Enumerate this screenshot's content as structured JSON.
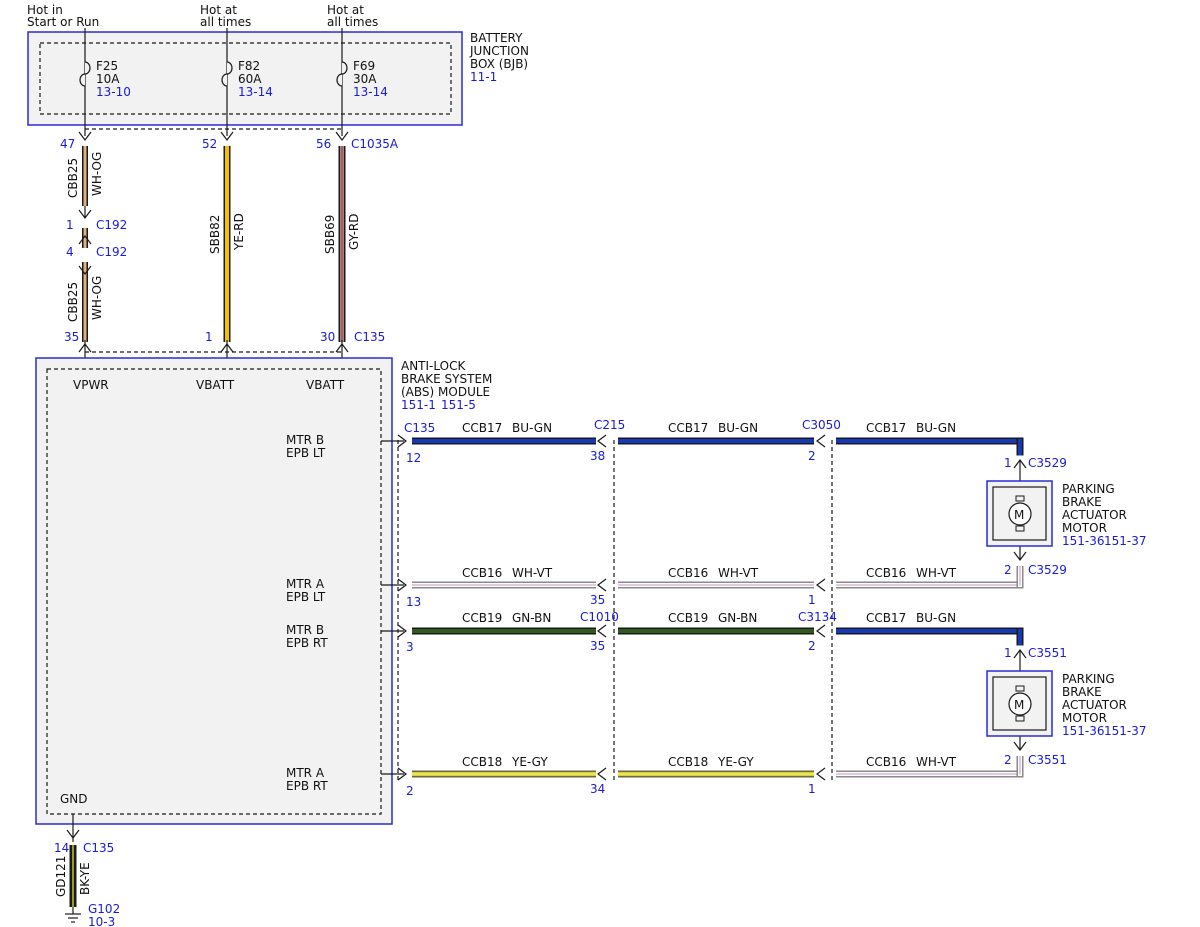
{
  "colors": {
    "label": "#111111",
    "ref": "#1a1adb",
    "box_border": "#2b2bd9",
    "box_fill": "#f2f2f2",
    "BU-GN": "#1538b8",
    "WH-VT": "#cfa4cf",
    "GN-BN": "#2f5a1e",
    "YE-GY": "#d8cf2a",
    "YE-RD": "#f2c200",
    "GY-RD": "#8c8c8c",
    "WH-OG": "#e0b080",
    "BK-YE": "#1a1a1a"
  },
  "top_labels": {
    "f25_l1": "Hot in",
    "f25_l2": "Start or Run",
    "f82_l1": "Hot at",
    "f82_l2": "all times",
    "f69_l1": "Hot at",
    "f69_l2": "all times"
  },
  "bjb": {
    "l1": "BATTERY",
    "l2": "JUNCTION",
    "l3": "BOX (BJB)",
    "ref": "11-1",
    "fuses": [
      {
        "name": "F25",
        "rating": "10A",
        "ref": "13-10"
      },
      {
        "name": "F82",
        "rating": "60A",
        "ref": "13-14"
      },
      {
        "name": "F69",
        "rating": "30A",
        "ref": "13-14"
      }
    ]
  },
  "vertical": {
    "pin47": "47",
    "pin52": "52",
    "pin56": "56",
    "c1035a": "C1035A",
    "cbb25": "CBB25",
    "whog": "WH-OG",
    "pin1a": "1",
    "c192a": "C192",
    "pin4": "4",
    "c192b": "C192",
    "sbb82": "SBB82",
    "yerd": "YE-RD",
    "sbb69": "SBB69",
    "gyrd": "GY-RD",
    "pin35": "35",
    "pin1b": "1",
    "pin30": "30",
    "c135": "C135"
  },
  "abs": {
    "l1": "ANTI-LOCK",
    "l2": "BRAKE SYSTEM",
    "l3": "(ABS) MODULE",
    "ref1": "151-1",
    "ref2": "151-5",
    "vpwr": "VPWR",
    "vbatt1": "VBATT",
    "vbatt2": "VBATT",
    "gnd": "GND",
    "pins": [
      {
        "l1": "MTR B",
        "l2": "EPB LT"
      },
      {
        "l1": "MTR A",
        "l2": "EPB LT"
      },
      {
        "l1": "MTR B",
        "l2": "EPB RT"
      },
      {
        "l1": "MTR A",
        "l2": "EPB RT"
      }
    ]
  },
  "rows": [
    {
      "s1": {
        "c": "CCB17",
        "w": "BU-GN"
      },
      "s2": {
        "c": "CCB17",
        "w": "BU-GN"
      },
      "s3": {
        "c": "CCB17",
        "w": "BU-GN"
      },
      "p1": "12",
      "p2": "38",
      "p3": "2",
      "conn1": "C135",
      "conn2": "C215",
      "conn3": "C3050"
    },
    {
      "s1": {
        "c": "CCB16",
        "w": "WH-VT"
      },
      "s2": {
        "c": "CCB16",
        "w": "WH-VT"
      },
      "s3": {
        "c": "CCB16",
        "w": "WH-VT"
      },
      "p1": "13",
      "p2": "35",
      "p3": "1"
    },
    {
      "s1": {
        "c": "CCB19",
        "w": "GN-BN"
      },
      "s2": {
        "c": "CCB19",
        "w": "GN-BN"
      },
      "s3": {
        "c": "CCB17",
        "w": "BU-GN"
      },
      "p1": "3",
      "p2": "35",
      "p3": "2",
      "conn2": "C1010",
      "conn3": "C3134"
    },
    {
      "s1": {
        "c": "CCB18",
        "w": "YE-GY"
      },
      "s2": {
        "c": "CCB18",
        "w": "YE-GY"
      },
      "s3": {
        "c": "CCB16",
        "w": "WH-VT"
      },
      "p1": "2",
      "p2": "34",
      "p3": "1"
    }
  ],
  "motors": [
    {
      "pin_top": "1",
      "conn_top": "C3529",
      "pin_bot": "2",
      "conn_bot": "C3529",
      "l1": "PARKING",
      "l2": "BRAKE",
      "l3": "ACTUATOR",
      "l4": "MOTOR",
      "ref1": "151-36",
      "ref2": "151-37",
      "symbol": "M"
    },
    {
      "pin_top": "1",
      "conn_top": "C3551",
      "pin_bot": "2",
      "conn_bot": "C3551",
      "l1": "PARKING",
      "l2": "BRAKE",
      "l3": "ACTUATOR",
      "l4": "MOTOR",
      "ref1": "151-36",
      "ref2": "151-37",
      "symbol": "M"
    }
  ],
  "ground": {
    "pin": "14",
    "conn": "C135",
    "circuit": "GD121",
    "wire": "BK-YE",
    "g": "G102",
    "ref": "10-3"
  }
}
